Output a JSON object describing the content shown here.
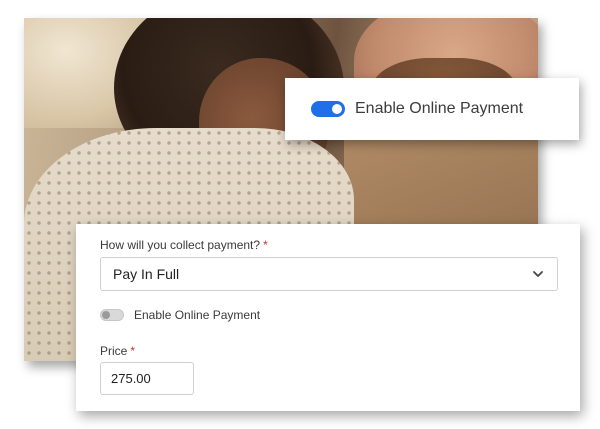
{
  "callout": {
    "toggle_state": "on",
    "label": "Enable Online Payment",
    "accent_color": "#1f6feb"
  },
  "form": {
    "collect_payment": {
      "label": "How will you collect payment?",
      "required_mark": "*",
      "selected_value": "Pay In Full",
      "icon": "chevron-down-icon"
    },
    "online_payment": {
      "toggle_state": "off",
      "label": "Enable Online Payment"
    },
    "price": {
      "label": "Price",
      "required_mark": "*",
      "value": "275.00"
    }
  },
  "colors": {
    "required": "#d32f2f"
  }
}
